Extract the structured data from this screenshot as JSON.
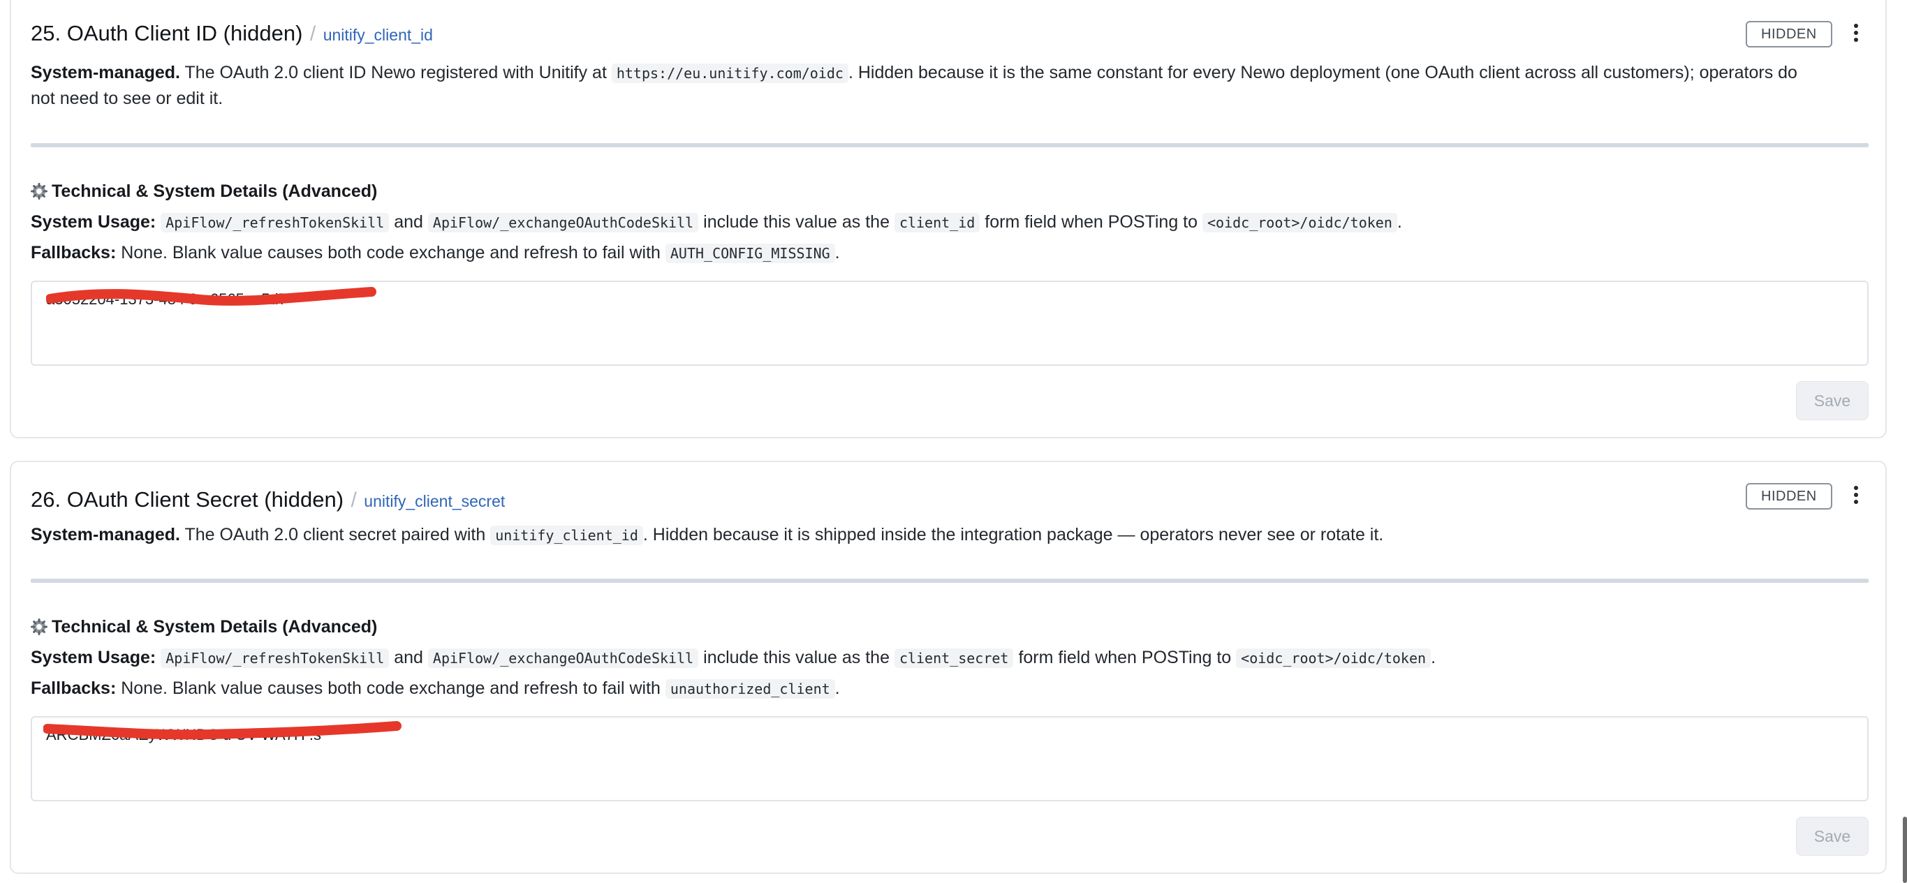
{
  "cards": [
    {
      "title": "25. OAuth Client ID (hidden)",
      "separator": "/",
      "key": "unitify_client_id",
      "badge": "HIDDEN",
      "desc_lead": "System-managed.",
      "desc_text1": " The OAuth 2.0 client ID Newo registered with Unitify at ",
      "desc_code": "https://eu.unitify.com/oidc",
      "desc_text2": ". Hidden because it is the same constant for every Newo deployment (one OAuth client across all customers); operators do",
      "desc_text3": "not need to see or edit it.",
      "section_title": "Technical & System Details (Advanced)",
      "usage_label": "System Usage:",
      "usage_code1": "ApiFlow/_refreshTokenSkill",
      "usage_and": "and",
      "usage_code2": "ApiFlow/_exchangeOAuthCodeSkill",
      "usage_text1": "include this value as the",
      "usage_field": "client_id",
      "usage_text2": "form field when POSTing to",
      "usage_endpoint": "<oidc_root>/oidc/token",
      "usage_end": ".",
      "fallbacks_label": "Fallbacks:",
      "fallbacks_text": " None. Blank value causes both code exchange and refresh to fail with ",
      "fallbacks_code": "AUTH_CONFIG_MISSING",
      "fallbacks_end": ".",
      "value": "a3052204-1373-484 0c-6565 a.5d7",
      "save_label": "Save"
    },
    {
      "title": "26. OAuth Client Secret (hidden)",
      "separator": "/",
      "key": "unitify_client_secret",
      "badge": "HIDDEN",
      "desc_lead": "System-managed.",
      "desc_text1": " The OAuth 2.0 client secret paired with ",
      "desc_code": "unitify_client_id",
      "desc_text2": ". Hidden because it is shipped inside the integration package — operators never see or rotate it.",
      "section_title": "Technical & System Details (Advanced)",
      "usage_label": "System Usage:",
      "usage_code1": "ApiFlow/_refreshTokenSkill",
      "usage_and": "and",
      "usage_code2": "ApiFlow/_exchangeOAuthCodeSkill",
      "usage_text1": "include this value as the",
      "usage_field": "client_secret",
      "usage_text2": "form field when POSTing to",
      "usage_endpoint": "<oidc_root>/oidc/token",
      "usage_end": ".",
      "fallbacks_label": "Fallbacks:",
      "fallbacks_text": " None. Blank value causes both code exchange and refresh to fail with ",
      "fallbacks_code": "unauthorized_client",
      "fallbacks_end": ".",
      "value": "ARCBMZ6aAEyWWNDC  u  UV-WA7H   .s",
      "save_label": "Save"
    }
  ],
  "colors": {
    "key_link": "#2f66b8",
    "redaction": "#e5382b",
    "divider": "#d3dae3",
    "save_disabled_bg": "#eef0f3"
  },
  "icons": {
    "section": "gear-icon",
    "menu": "kebab-menu-icon"
  }
}
